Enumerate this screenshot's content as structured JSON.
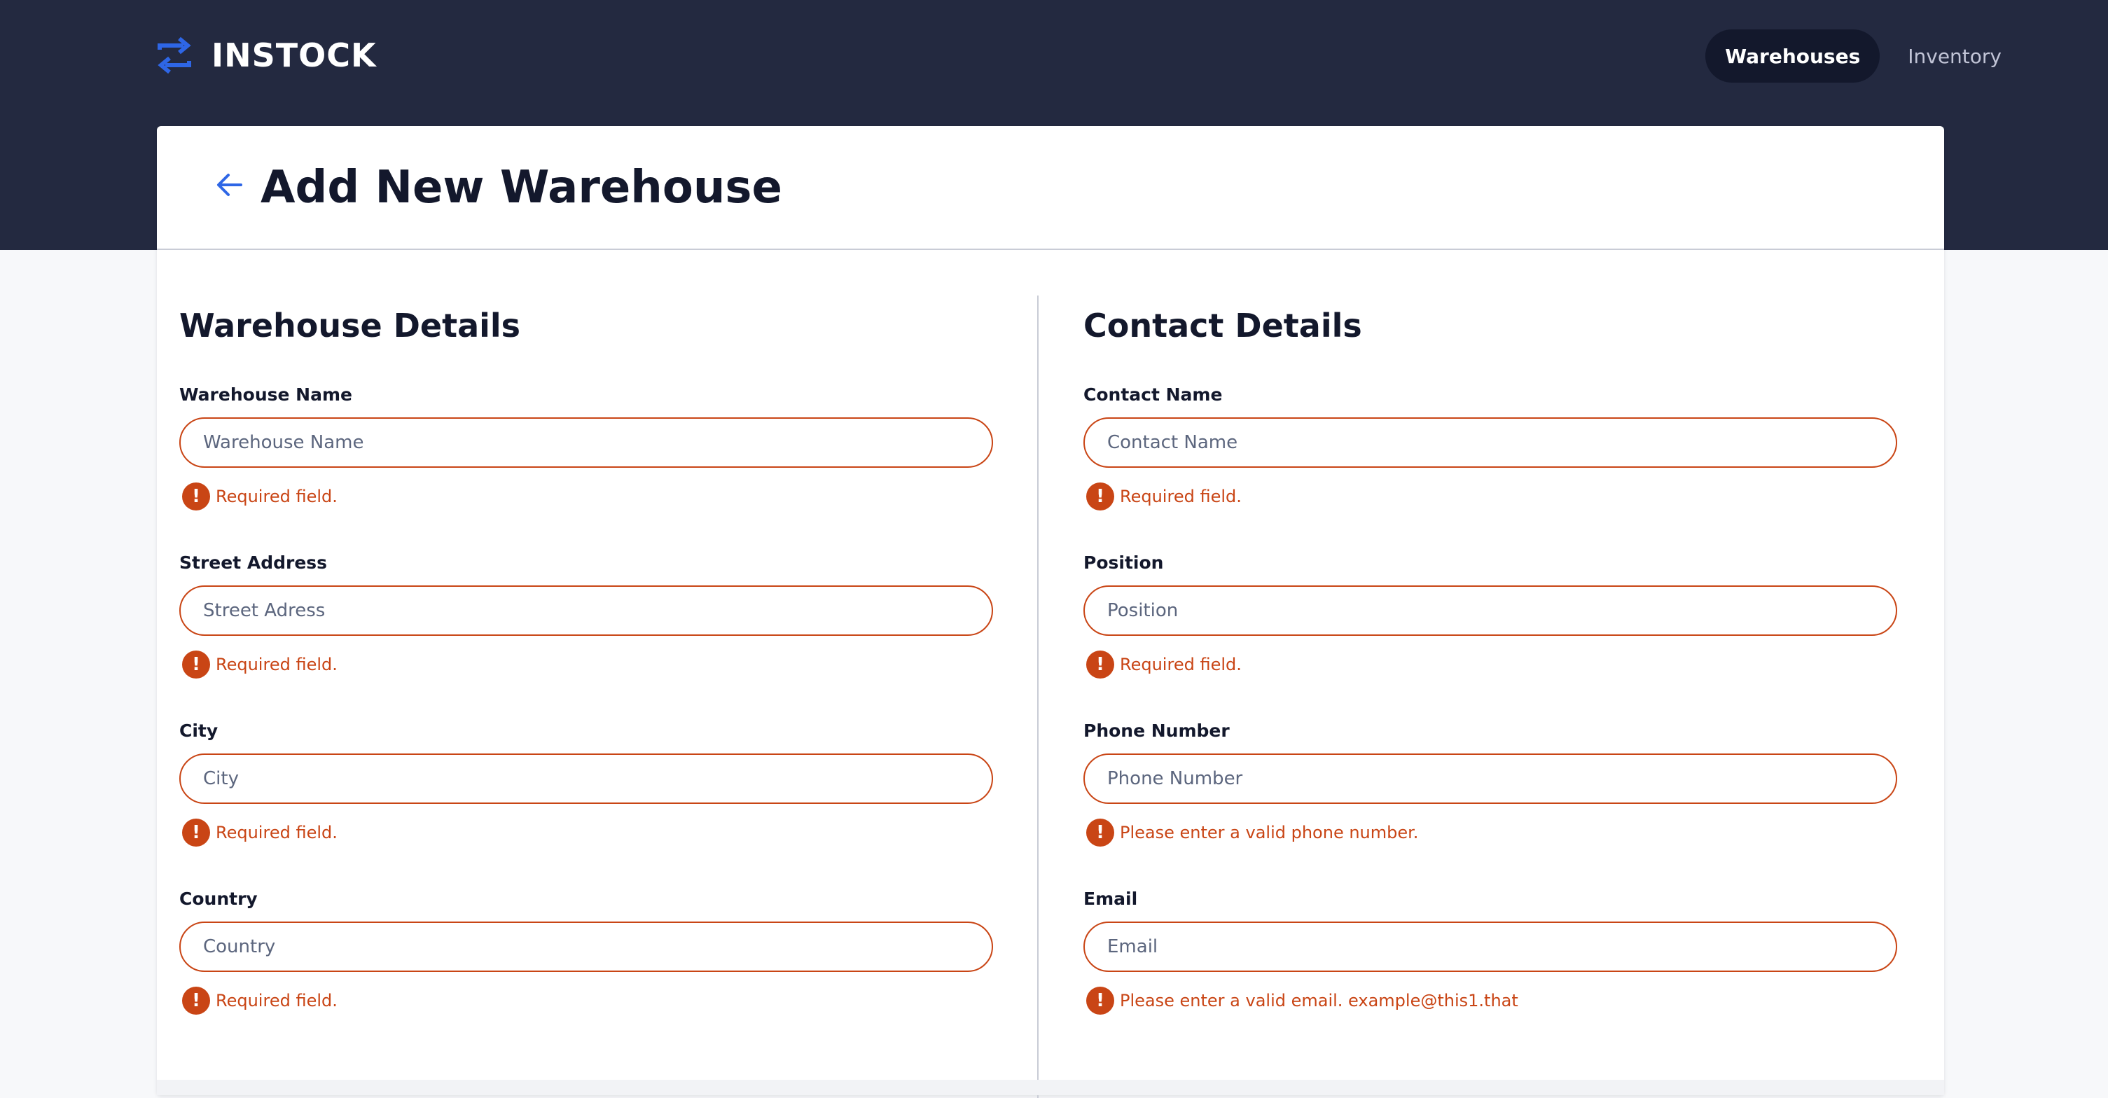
{
  "app": {
    "logo_text": "INSTOCK",
    "accent_color": "#2e66e6",
    "error_color": "#c94515",
    "header_color": "#232940"
  },
  "nav": {
    "items": [
      {
        "label": "Warehouses",
        "active": true
      },
      {
        "label": "Inventory",
        "active": false
      }
    ]
  },
  "page": {
    "title": "Add New Warehouse",
    "back_icon": "arrow-left-icon"
  },
  "warehouse_section": {
    "title": "Warehouse Details",
    "fields": [
      {
        "label": "Warehouse Name",
        "placeholder": "Warehouse Name",
        "value": "",
        "error": "Required field."
      },
      {
        "label": "Street Address",
        "placeholder": "Street Adress",
        "value": "",
        "error": "Required field."
      },
      {
        "label": "City",
        "placeholder": "City",
        "value": "",
        "error": "Required field."
      },
      {
        "label": "Country",
        "placeholder": "Country",
        "value": "",
        "error": "Required field."
      }
    ]
  },
  "contact_section": {
    "title": "Contact Details",
    "fields": [
      {
        "label": "Contact Name",
        "placeholder": "Contact Name",
        "value": "",
        "error": "Required field."
      },
      {
        "label": "Position",
        "placeholder": "Position",
        "value": "",
        "error": "Required field."
      },
      {
        "label": "Phone Number",
        "placeholder": "Phone Number",
        "value": "",
        "error": "Please enter a valid phone number."
      },
      {
        "label": "Email",
        "placeholder": "Email",
        "value": "",
        "error": "Please enter a valid email. example@this1.that"
      }
    ]
  },
  "error_icon": {
    "glyph": "!",
    "name": "error-icon"
  }
}
